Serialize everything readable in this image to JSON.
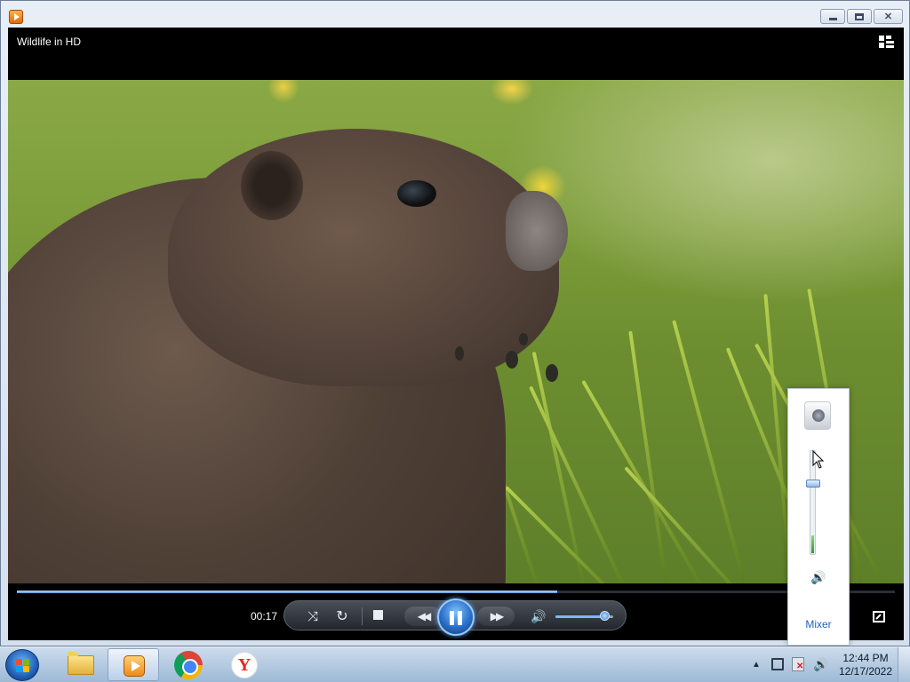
{
  "window": {
    "icon": "windows-media-player-icon",
    "min_icon": "minimize-icon",
    "max_icon": "maximize-icon",
    "close_icon": "close-icon",
    "close_glyph": "✕"
  },
  "player": {
    "media_title": "Wildlife in HD",
    "elapsed": "00:17",
    "progress_fraction": 0.615,
    "volume_fraction": 0.85,
    "buttons": {
      "shuffle_glyph": "⤨",
      "repeat_glyph": "↻",
      "prev_glyph": "◀◀",
      "next_glyph": "▶▶",
      "mute_glyph": "🔊"
    }
  },
  "volume_popup": {
    "device_icon": "speaker-device-icon",
    "level_fraction": 0.17,
    "mixer_label": "Mixer",
    "speaker_glyph": "🔊"
  },
  "taskbar": {
    "apps": [
      "explorer",
      "windows-media-player",
      "chrome",
      "yandex"
    ],
    "yandex_letter": "Y",
    "tray": {
      "arrow_glyph": "▲",
      "volume_glyph": "🔊"
    },
    "clock": {
      "time": "12:44 PM",
      "date": "12/17/2022"
    }
  },
  "colors": {
    "accent": "#2a6fc9",
    "mixer_link": "#1f63c4"
  }
}
